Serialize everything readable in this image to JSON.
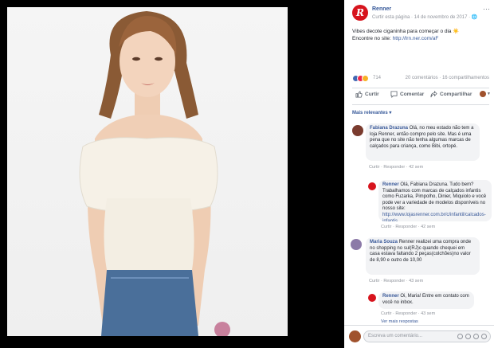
{
  "page": {
    "name": "Renner",
    "meta": "Curtir esta página · 14 de novembro de 2017 · 🌐"
  },
  "post": {
    "text_line1": "Vibes decote ciganinha para começar o dia ☀️",
    "text_line2_prefix": "Encontre no site: ",
    "text_link": "http://lrn.ner.com/aF",
    "reaction_count": "714",
    "counts": "20 comentários · 16 compartilhamentos"
  },
  "actions": {
    "like": "Curtir",
    "comment": "Comentar",
    "share": "Compartilhar"
  },
  "comments_filter": "Mais relevantes ▾",
  "comments": [
    {
      "author": "Fabiana Drazuna",
      "text": "Olá, no meu estado não tem a loja Renner, então compro pelo site. Mas é uma pena que no site não tenha algumas marcas de calçados para criança, como Bibi, ortopé.",
      "actions": "Curtir · Responder · 42 sem"
    },
    {
      "author": "Renner",
      "text": "Olá, Fabiana Drazuna. Tudo bem? Trabalhamos com marcas de calçados infantis como Fuzarka, Pimpolho, Dinier, Miquiolo e você pode ver a variedade de modelos disponíveis no nosso site:",
      "link": "http://www.lojasrenner.com.br/c/infantil/calcados-infantis",
      "actions": "Curtir · Responder · 42 sem"
    },
    {
      "author": "Maria Souza",
      "text": "Renner realizei uma compra onde no shopping no sul(RJ)c quando chequei em casa estava faltando 2 peças(colchões)no valor de 8,90 e outro de 10,00",
      "actions": "Curtir · Responder · 43 sem"
    },
    {
      "author": "Renner",
      "text": "Oi, Maria! Entre em contato com você no inbox.",
      "actions": "Curtir · Responder · 43 sem"
    }
  ],
  "more_replies": "Ver mais respostas",
  "composer": {
    "placeholder": "Escreva um comentário..."
  }
}
